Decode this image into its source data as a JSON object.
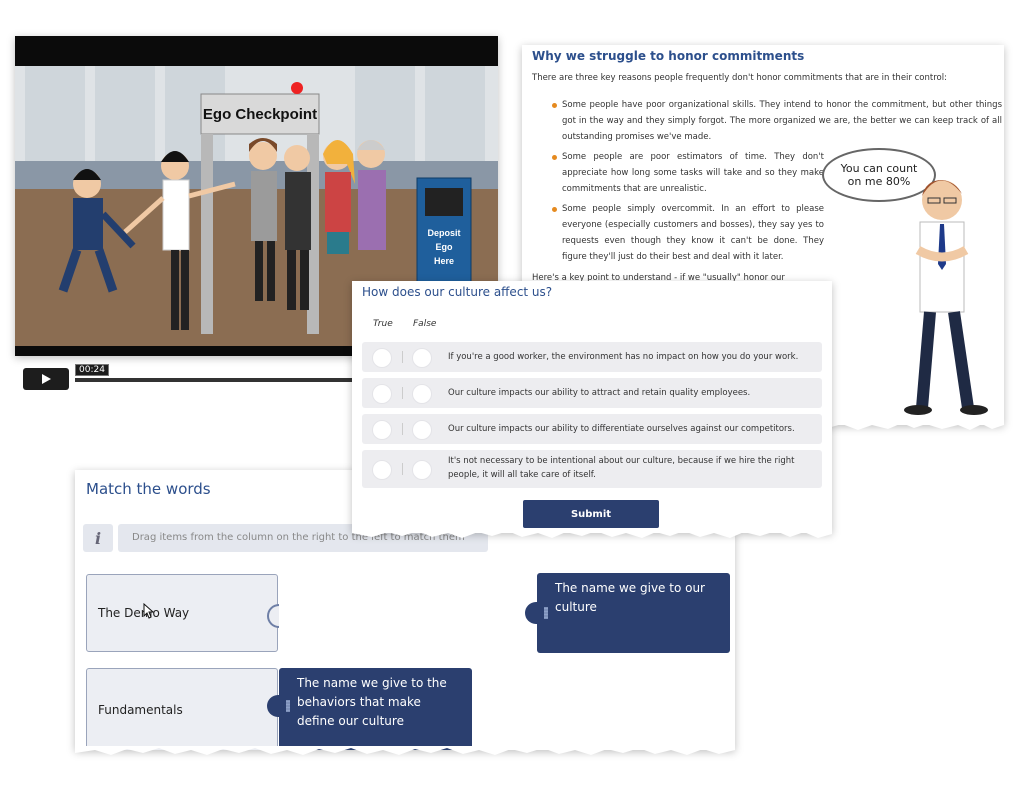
{
  "video": {
    "sign_text": "Ego Checkpoint",
    "deposit_text": [
      "Deposit",
      "Ego",
      "Here"
    ],
    "time": "00:24"
  },
  "article": {
    "title": "Why we struggle to honor commitments",
    "intro": "There are three key reasons people frequently don't honor commitments that are in their control:",
    "bullets": [
      "Some people have poor organizational skills. They intend to honor the commitment, but other things got in the way and they simply forgot. The more organized we are, the better we can keep track of all outstanding promises we've made.",
      "Some people are poor estimators of time. They don't appreciate how long some tasks will take and so they make commitments that are unrealistic.",
      "Some people simply overcommit. In an effort to please everyone (especially customers and bosses), they say yes to requests even though they know it can't be done. They figure they'll just do their best and deal with it later."
    ],
    "bubble_text": [
      "You can count",
      "on me 80%"
    ],
    "key_point": "Here's a key point to understand - if we \"usually\" honor our"
  },
  "quiz": {
    "title": "How does our culture affect us?",
    "true_label": "True",
    "false_label": "False",
    "questions": [
      "If you're a good worker, the environment has no impact on how you do your work.",
      "Our culture impacts our ability to attract and retain quality employees.",
      "Our culture impacts our ability to differentiate ourselves against our competitors.",
      "It's not necessary to be intentional about our culture, because if we hire the right people, it will all take care of itself."
    ],
    "submit_label": "Submit"
  },
  "match": {
    "title": "Match the words",
    "info_icon": "i",
    "hint": "Drag items from the column on the right to the left to match them",
    "left_items": [
      "The Demo Way",
      "Fundamentals"
    ],
    "drag_items": [
      "The name we give to our culture",
      "The name we give to the behaviors that make define our culture"
    ]
  },
  "colors": {
    "title_blue": "#2c4f8c",
    "navy": "#2b3f6f",
    "bullet_orange": "#e58a1f"
  }
}
